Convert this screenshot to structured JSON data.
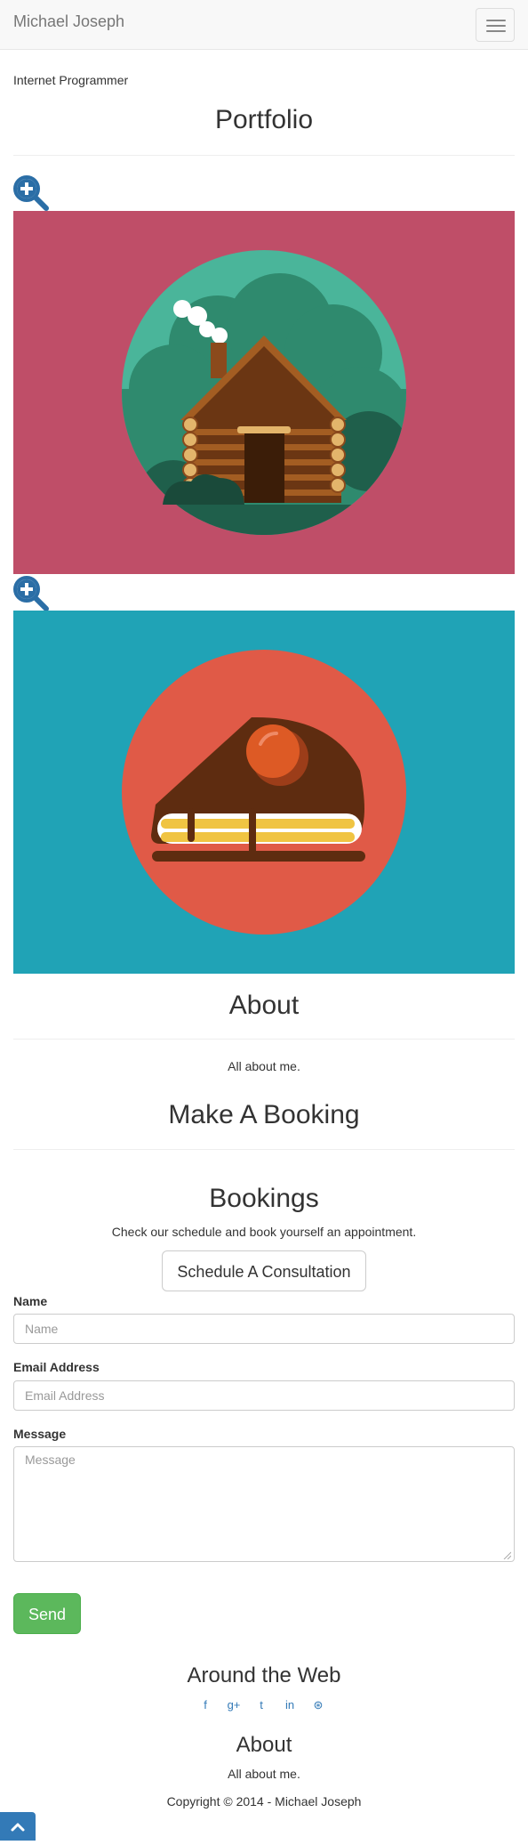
{
  "navbar": {
    "brand": "Michael Joseph",
    "toggle_icon": "hamburger-icon"
  },
  "header": {
    "subtitle": "Internet Programmer"
  },
  "portfolio": {
    "title": "Portfolio",
    "items": [
      {
        "image": "log-cabin-illustration",
        "background": "#bf4e68",
        "zoom_icon": "zoom-in-icon"
      },
      {
        "image": "cake-slice-illustration",
        "background": "#20a3b6",
        "zoom_icon": "zoom-in-icon"
      }
    ]
  },
  "about": {
    "title": "About",
    "text": "All about me."
  },
  "booking": {
    "title": "Make A Booking",
    "subtitle": "Bookings",
    "text": "Check our schedule and book yourself an appointment.",
    "button": "Schedule A Consultation"
  },
  "form": {
    "name_label": "Name",
    "name_placeholder": "Name",
    "email_label": "Email Address",
    "email_placeholder": "Email Address",
    "message_label": "Message",
    "message_placeholder": "Message",
    "send_button": "Send"
  },
  "footer": {
    "web_title": "Around the Web",
    "social": [
      {
        "icon": "facebook-icon",
        "glyph": "f"
      },
      {
        "icon": "google-plus-icon",
        "glyph": "g+"
      },
      {
        "icon": "twitter-icon",
        "glyph": "t"
      },
      {
        "icon": "linkedin-icon",
        "glyph": "in"
      },
      {
        "icon": "dribbble-icon",
        "glyph": "⊛"
      }
    ],
    "about_title": "About",
    "about_text": "All about me.",
    "copyright": "Copyright © 2014 - Michael Joseph"
  },
  "colors": {
    "accent": "#337ab7",
    "success": "#5cb85c",
    "text": "#333333"
  }
}
